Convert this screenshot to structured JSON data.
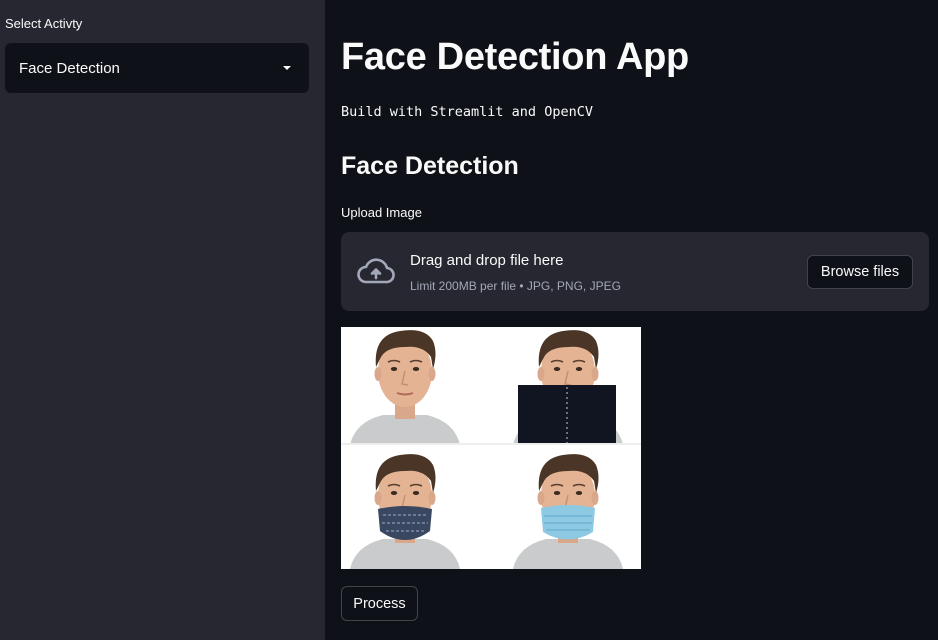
{
  "sidebar": {
    "label": "Select Activty",
    "select": {
      "value": "Face Detection"
    }
  },
  "main": {
    "title": "Face Detection App",
    "subtitle": "Build with Streamlit and OpenCV",
    "section_title": "Face Detection",
    "upload": {
      "label": "Upload Image",
      "drop_title": "Drag and drop file here",
      "limit_text": "Limit 200MB per file • JPG, PNG, JPEG",
      "browse_label": "Browse files"
    },
    "process_label": "Process"
  },
  "colors": {
    "app_background": "#0e1117",
    "sidebar_background": "#262730",
    "text": "#fafafa",
    "muted_text": "#a3a8b8",
    "dark_mask": "#3a4760",
    "surgical_mask": "#8ec9e3"
  },
  "icons": {
    "upload": "cloud-upload-icon",
    "select_caret": "caret-down-icon"
  }
}
